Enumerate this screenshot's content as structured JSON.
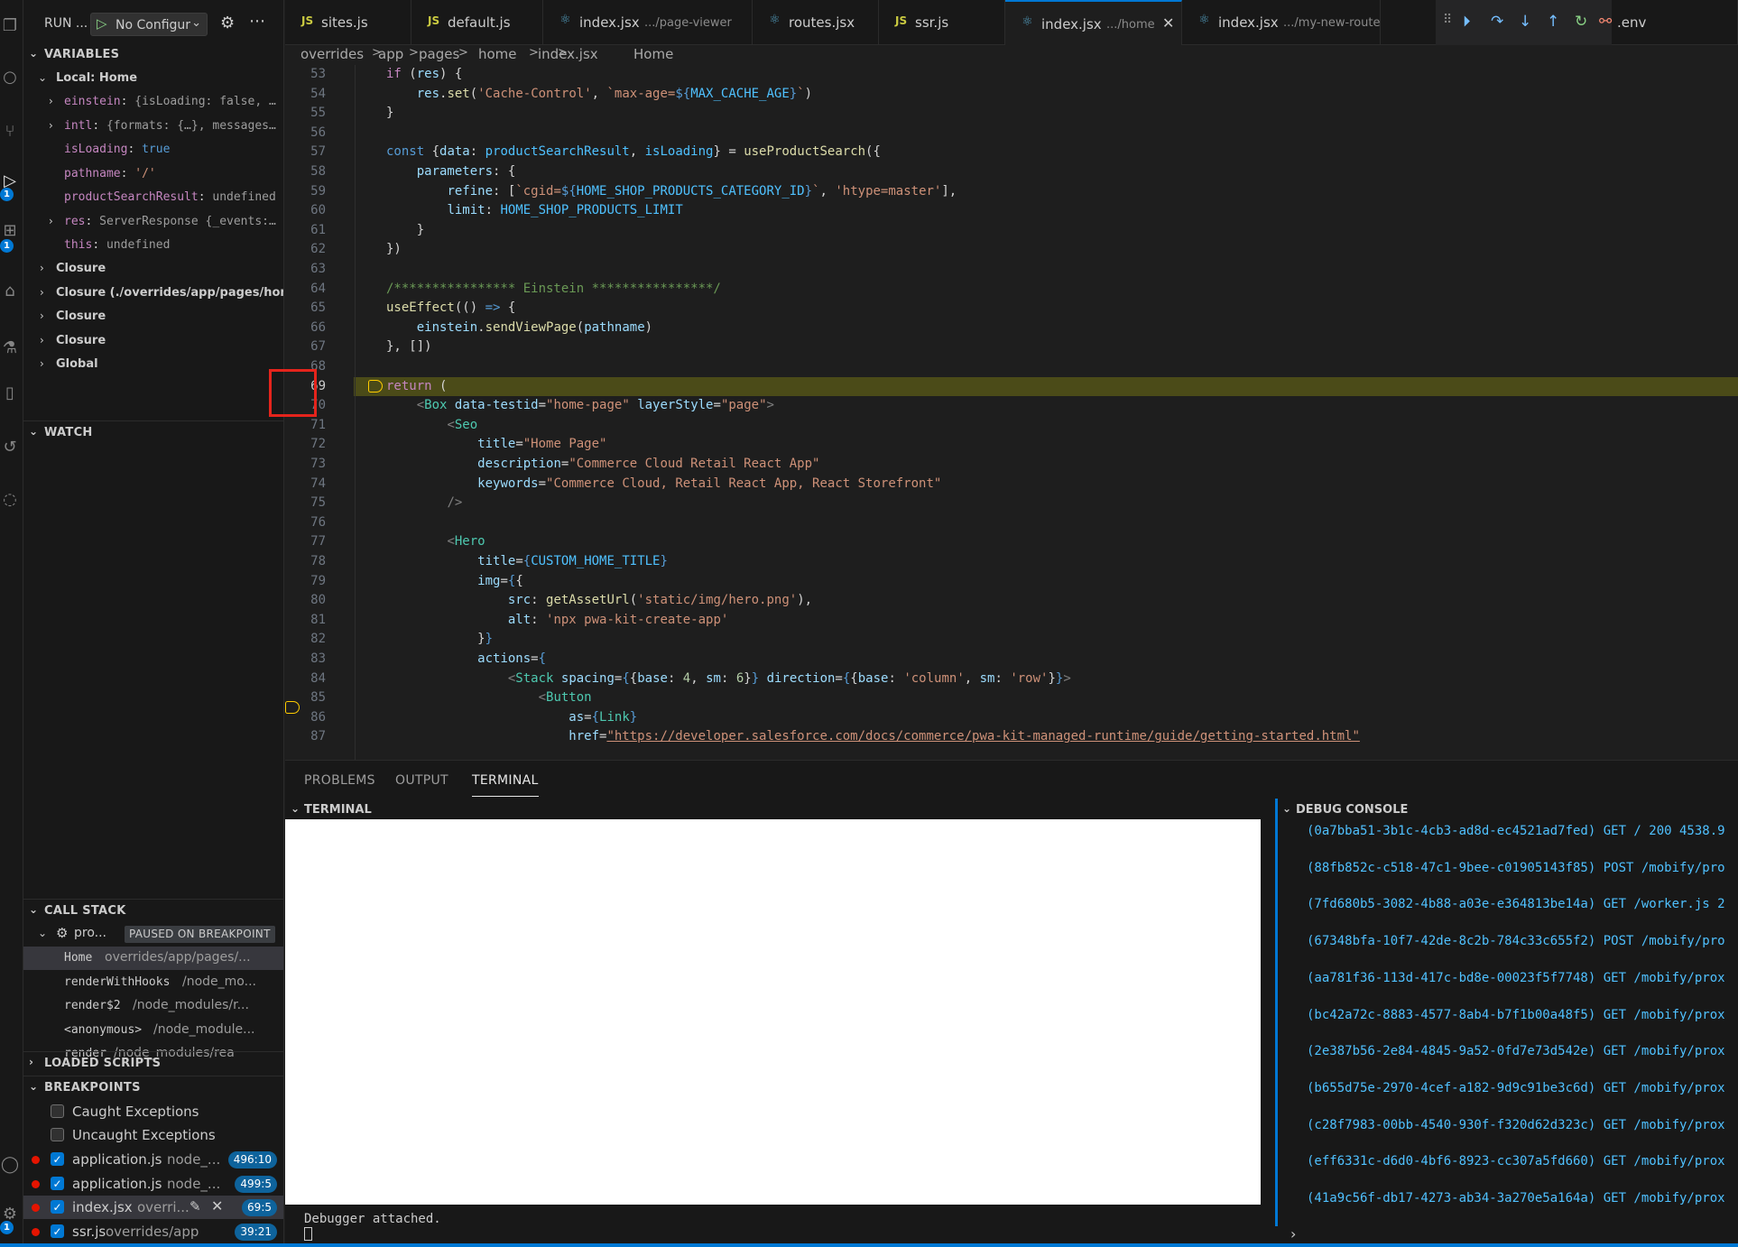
{
  "sidebar": {
    "run_title": "RUN ...",
    "config_label": "No Configur",
    "variables_title": "VARIABLES",
    "local_scope": "Local: Home",
    "variables": [
      {
        "name": "einstein",
        "sep": ": ",
        "value": "{isLoading: false, …",
        "expandable": true
      },
      {
        "name": "intl",
        "sep": ": ",
        "value": "{formats: {…}, messages…",
        "expandable": true
      },
      {
        "name": "isLoading",
        "sep": ": ",
        "value": "true",
        "expandable": false
      },
      {
        "name": "pathname",
        "sep": ": ",
        "value": "'/'",
        "expandable": false
      },
      {
        "name": "productSearchResult",
        "sep": ": ",
        "value": "undefined",
        "expandable": false
      },
      {
        "name": "res",
        "sep": ": ",
        "value": "ServerResponse {_events:…",
        "expandable": true
      },
      {
        "name": "this",
        "sep": ": ",
        "value": "undefined",
        "expandable": false
      }
    ],
    "scopes": [
      "Closure",
      "Closure (./overrides/app/pages/home",
      "Closure",
      "Closure",
      "Global"
    ],
    "watch_title": "WATCH",
    "callstack_title": "CALL STACK",
    "callstack_process": "pro...",
    "paused_label": "PAUSED ON BREAKPOINT",
    "frames": [
      {
        "fn": "Home",
        "path": "overrides/app/pages/..."
      },
      {
        "fn": "renderWithHooks",
        "path": "/node_mo..."
      },
      {
        "fn": "render$2",
        "path": "/node_modules/r..."
      },
      {
        "fn": "<anonymous>",
        "path": "/node_module..."
      },
      {
        "fn": "render",
        "path": "/node_modules/rea"
      }
    ],
    "loaded_scripts_title": "LOADED SCRIPTS",
    "breakpoints_title": "BREAKPOINTS",
    "caught_label": "Caught Exceptions",
    "uncaught_label": "Uncaught Exceptions",
    "breakpoints": [
      {
        "file": "application.js",
        "path": "node_...",
        "line": "496:10"
      },
      {
        "file": "application.js",
        "path": "node_...",
        "line": "499:5"
      },
      {
        "file": "index.jsx",
        "path": "overri...",
        "line": "69:5"
      },
      {
        "file": "ssr.js",
        "path": "overrides/app",
        "line": "39:21"
      }
    ],
    "badges": [
      "1",
      "1",
      "1"
    ]
  },
  "tabs": [
    {
      "icon": "JS",
      "name": "sites.js",
      "desc": ""
    },
    {
      "icon": "JS",
      "name": "default.js",
      "desc": ""
    },
    {
      "icon": "⚛",
      "name": "index.jsx",
      "desc": ".../page-viewer"
    },
    {
      "icon": "⚛",
      "name": "routes.jsx",
      "desc": ""
    },
    {
      "icon": "JS",
      "name": "ssr.js",
      "desc": ""
    },
    {
      "icon": "⚛",
      "name": "index.jsx",
      "desc": ".../home"
    },
    {
      "icon": "⚛",
      "name": "index.jsx",
      "desc": ".../my-new-route"
    },
    {
      "icon": "",
      "name": ".env",
      "desc": ""
    }
  ],
  "breadcrumb": [
    "overrides",
    ">",
    "app",
    ">",
    "pages",
    ">",
    "home",
    ">",
    "index.jsx",
    ">",
    "Home"
  ],
  "editor": {
    "line_numbers": [
      "53",
      "54",
      "55",
      "56",
      "57",
      "58",
      "59",
      "60",
      "61",
      "62",
      "63",
      "64",
      "65",
      "66",
      "67",
      "68",
      "69",
      "70",
      "71",
      "72",
      "73",
      "74",
      "75",
      "76",
      "77",
      "78",
      "79",
      "80",
      "81",
      "82",
      "83",
      "84",
      "85",
      "86",
      "87"
    ],
    "current_line": "69"
  },
  "panel": {
    "tabs": [
      "PROBLEMS",
      "OUTPUT",
      "TERMINAL"
    ],
    "terminal_title": "TERMINAL",
    "terminal_status": "Debugger attached.",
    "debug_title": "DEBUG CONSOLE",
    "logs": [
      "(0a7bba51-3b1c-4cb3-ad8d-ec4521ad7fed) GET / 200 4538.9",
      "(88fb852c-c518-47c1-9bee-c01905143f85) POST /mobify/pro",
      "(7fd680b5-3082-4b88-a03e-e364813be14a) GET /worker.js 2",
      "(67348bfa-10f7-42de-8c2b-784c33c655f2) POST /mobify/pro",
      "(aa781f36-113d-417c-bd8e-00023f5f7748) GET /mobify/prox",
      "(bc42a72c-8883-4577-8ab4-b7f1b00a48f5) GET /mobify/prox",
      "(2e387b56-2e84-4845-9a52-0fd7e73d542e) GET /mobify/prox",
      "(b655d75e-2970-4cef-a182-9d9c91be3c6d) GET /mobify/prox",
      "(c28f7983-00bb-4540-930f-f320d62d323c) GET /mobify/prox",
      "(eff6331c-d6d0-4bf6-8923-cc307a5fd660) GET /mobify/prox",
      "(41a9c56f-db17-4273-ab34-3a270e5a164a) GET /mobify/prox"
    ]
  },
  "colors": {
    "accent": "#0078d4",
    "breakpoint": "#e51400",
    "highlight_line": "#4b4b18",
    "annotation": "#e5241c"
  }
}
